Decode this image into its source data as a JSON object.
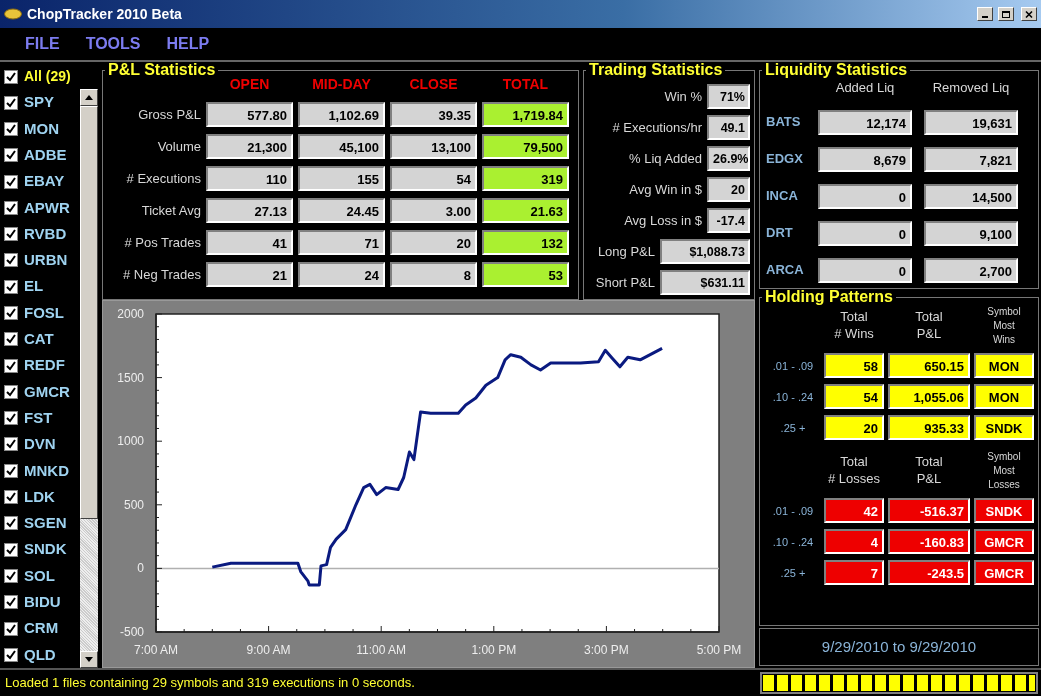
{
  "window": {
    "title": "ChopTracker 2010 Beta"
  },
  "menu": [
    "FILE",
    "TOOLS",
    "HELP"
  ],
  "symbols": {
    "all": {
      "label": "All (29)",
      "checked": true
    },
    "items": [
      {
        "label": "SPY",
        "checked": true
      },
      {
        "label": "MON",
        "checked": true
      },
      {
        "label": "ADBE",
        "checked": true
      },
      {
        "label": "EBAY",
        "checked": true
      },
      {
        "label": "APWR",
        "checked": true
      },
      {
        "label": "RVBD",
        "checked": true
      },
      {
        "label": "URBN",
        "checked": true
      },
      {
        "label": "EL",
        "checked": true
      },
      {
        "label": "FOSL",
        "checked": true
      },
      {
        "label": "CAT",
        "checked": true
      },
      {
        "label": "REDF",
        "checked": true
      },
      {
        "label": "GMCR",
        "checked": true
      },
      {
        "label": "FST",
        "checked": true
      },
      {
        "label": "DVN",
        "checked": true
      },
      {
        "label": "MNKD",
        "checked": true
      },
      {
        "label": "LDK",
        "checked": true
      },
      {
        "label": "SGEN",
        "checked": true
      },
      {
        "label": "SNDK",
        "checked": true
      },
      {
        "label": "SOL",
        "checked": true
      },
      {
        "label": "BIDU",
        "checked": true
      },
      {
        "label": "CRM",
        "checked": true
      },
      {
        "label": "QLD",
        "checked": true
      }
    ]
  },
  "pnl_statistics": {
    "title": "P&L Statistics",
    "columns": [
      {
        "label": "OPEN",
        "highlight": false
      },
      {
        "label": "MID-DAY",
        "highlight": false
      },
      {
        "label": "CLOSE",
        "highlight": false
      },
      {
        "label": "TOTAL",
        "highlight": true
      }
    ],
    "rows": [
      {
        "label": "Gross P&L",
        "values": [
          "577.80",
          "1,102.69",
          "39.35",
          "1,719.84"
        ]
      },
      {
        "label": "Volume",
        "values": [
          "21,300",
          "45,100",
          "13,100",
          "79,500"
        ]
      },
      {
        "label": "# Executions",
        "values": [
          "110",
          "155",
          "54",
          "319"
        ]
      },
      {
        "label": "Ticket Avg",
        "values": [
          "27.13",
          "24.45",
          "3.00",
          "21.63"
        ]
      },
      {
        "label": "# Pos Trades",
        "values": [
          "41",
          "71",
          "20",
          "132"
        ]
      },
      {
        "label": "# Neg Trades",
        "values": [
          "21",
          "24",
          "8",
          "53"
        ]
      }
    ]
  },
  "trading_statistics": {
    "title": "Trading Statistics",
    "rows": [
      {
        "kind": "short",
        "label": "Win %",
        "value": "71%"
      },
      {
        "kind": "short",
        "label": "# Executions/hr",
        "value": "49.1"
      },
      {
        "kind": "short",
        "label": "% Liq Added",
        "value": "26.9%"
      },
      {
        "kind": "short",
        "label": "Avg Win in $",
        "value": "20"
      },
      {
        "kind": "short",
        "label": "Avg Loss in $",
        "value": "-17.4"
      },
      {
        "kind": "wide",
        "label": "Long P&L",
        "value": "$1,088.73"
      },
      {
        "kind": "wide",
        "label": "Short P&L",
        "value": "$631.11"
      }
    ]
  },
  "liquidity_statistics": {
    "title": "Liquidity Statistics",
    "columns": [
      "Added Liq",
      "Removed Liq"
    ],
    "rows": [
      {
        "label": "BATS",
        "values": [
          "12,174",
          "19,631"
        ]
      },
      {
        "label": "EDGX",
        "values": [
          "8,679",
          "7,821"
        ]
      },
      {
        "label": "INCA",
        "values": [
          "0",
          "14,500"
        ]
      },
      {
        "label": "DRT",
        "values": [
          "0",
          "9,100"
        ]
      },
      {
        "label": "ARCA",
        "values": [
          "0",
          "2,700"
        ]
      }
    ]
  },
  "chart": {
    "chart_data": {
      "type": "line",
      "x": [
        8.0,
        8.33,
        9.52,
        9.57,
        9.7,
        9.72,
        9.9,
        9.93,
        10.03,
        10.1,
        10.2,
        10.37,
        10.55,
        10.69,
        10.8,
        10.92,
        11.08,
        11.3,
        11.4,
        11.5,
        11.58,
        11.7,
        11.88,
        12.37,
        12.5,
        12.68,
        12.86,
        13.07,
        13.2,
        13.3,
        13.48,
        13.66,
        13.83,
        14.01,
        14.54,
        14.86,
        14.98,
        15.1,
        15.24,
        15.38,
        15.6,
        15.99
      ],
      "series": [
        {
          "color": "#0a1a80",
          "values": [
            10,
            40,
            40,
            -25,
            -100,
            -130,
            -130,
            20,
            30,
            165,
            230,
            305,
            500,
            635,
            660,
            580,
            635,
            620,
            715,
            915,
            855,
            1230,
            1220,
            1220,
            1285,
            1340,
            1440,
            1500,
            1640,
            1680,
            1660,
            1600,
            1560,
            1615,
            1615,
            1625,
            1715,
            1655,
            1585,
            1660,
            1640,
            1730
          ]
        }
      ],
      "xlim": [
        7,
        17
      ],
      "ylim": [
        -500,
        2000
      ],
      "xticks": [
        {
          "value": 7,
          "label": "7:00 AM"
        },
        {
          "value": 9,
          "label": "9:00 AM"
        },
        {
          "value": 11,
          "label": "11:00 AM"
        },
        {
          "value": 13,
          "label": "1:00 PM"
        },
        {
          "value": 15,
          "label": "3:00 PM"
        },
        {
          "value": 17,
          "label": "5:00 PM"
        }
      ],
      "yticks": [
        -500,
        0,
        500,
        1000,
        1500,
        2000
      ]
    }
  },
  "holding_patterns": {
    "title": "Holding Patterns",
    "groups": [
      {
        "kind": "wins",
        "columns": [
          "Total\n# Wins",
          "Total\nP&L",
          "Symbol\nMost\nWins"
        ],
        "rows": [
          {
            "label": ".01 - .09",
            "values": [
              "58",
              "650.15",
              "MON"
            ]
          },
          {
            "label": ".10 - .24",
            "values": [
              "54",
              "1,055.06",
              "MON"
            ]
          },
          {
            "label": ".25 +",
            "values": [
              "20",
              "935.33",
              "SNDK"
            ]
          }
        ]
      },
      {
        "kind": "losses",
        "columns": [
          "Total\n# Losses",
          "Total\nP&L",
          "Symbol\nMost\nLosses"
        ],
        "rows": [
          {
            "label": ".01 - .09",
            "values": [
              "42",
              "-516.37",
              "SNDK"
            ]
          },
          {
            "label": ".10 - .24",
            "values": [
              "4",
              "-160.83",
              "GMCR"
            ]
          },
          {
            "label": ".25 +",
            "values": [
              "7",
              "-243.5",
              "GMCR"
            ]
          }
        ]
      }
    ]
  },
  "date_range": "9/29/2010 to 9/29/2010",
  "status_bar": {
    "message": "Loaded 1 files containing 29 symbols and 319 executions in 0 seconds.",
    "progress": {
      "level": 1
    }
  }
}
